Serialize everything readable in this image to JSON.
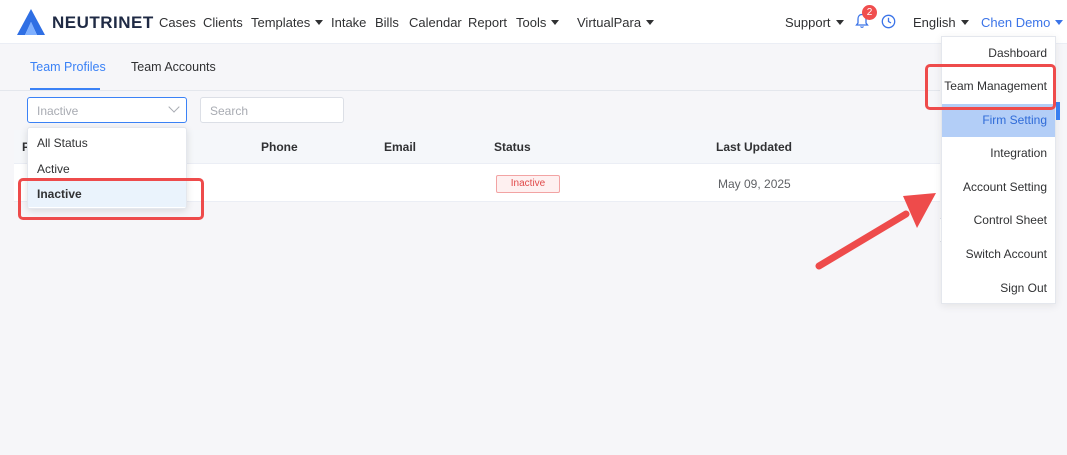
{
  "nav": {
    "brand": "NEUTRINET",
    "items": [
      {
        "label": "Cases",
        "dropdown": false
      },
      {
        "label": "Clients",
        "dropdown": false
      },
      {
        "label": "Templates",
        "dropdown": true
      },
      {
        "label": "Intake",
        "dropdown": false
      },
      {
        "label": "Bills",
        "dropdown": false
      },
      {
        "label": "Calendar",
        "dropdown": false
      },
      {
        "label": "Report",
        "dropdown": false
      },
      {
        "label": "Tools",
        "dropdown": true
      },
      {
        "label": "VirtualPara",
        "dropdown": true
      }
    ],
    "support": "Support",
    "notification_count": "2",
    "language": "English",
    "user": "Chen Demo"
  },
  "tabs": [
    {
      "label": "Team Profiles",
      "active": true
    },
    {
      "label": "Team Accounts",
      "active": false
    }
  ],
  "filters": {
    "status_value": "Inactive",
    "search_placeholder": "Search"
  },
  "status_options": [
    {
      "label": "All Status",
      "selected": false
    },
    {
      "label": "Active",
      "selected": false
    },
    {
      "label": "Inactive",
      "selected": true
    }
  ],
  "table": {
    "columns": [
      "P",
      "Phone",
      "Email",
      "Status",
      "Last Updated"
    ],
    "rows": [
      {
        "status": "Inactive",
        "last_updated": "May 09, 2025"
      }
    ]
  },
  "user_menu": [
    {
      "label": "Dashboard",
      "highlighted": false
    },
    {
      "label": "Team Management",
      "highlighted": false
    },
    {
      "label": "Firm Setting",
      "highlighted": true
    },
    {
      "label": "Integration",
      "highlighted": false
    },
    {
      "label": "Account Setting",
      "highlighted": false
    },
    {
      "label": "Control Sheet",
      "highlighted": false
    },
    {
      "label": "Switch Account",
      "highlighted": false
    },
    {
      "label": "Sign Out",
      "highlighted": false
    }
  ],
  "colors": {
    "accent": "#3b82f6",
    "annotation": "#ee4b4b",
    "status_inactive": "#e04a4a"
  }
}
